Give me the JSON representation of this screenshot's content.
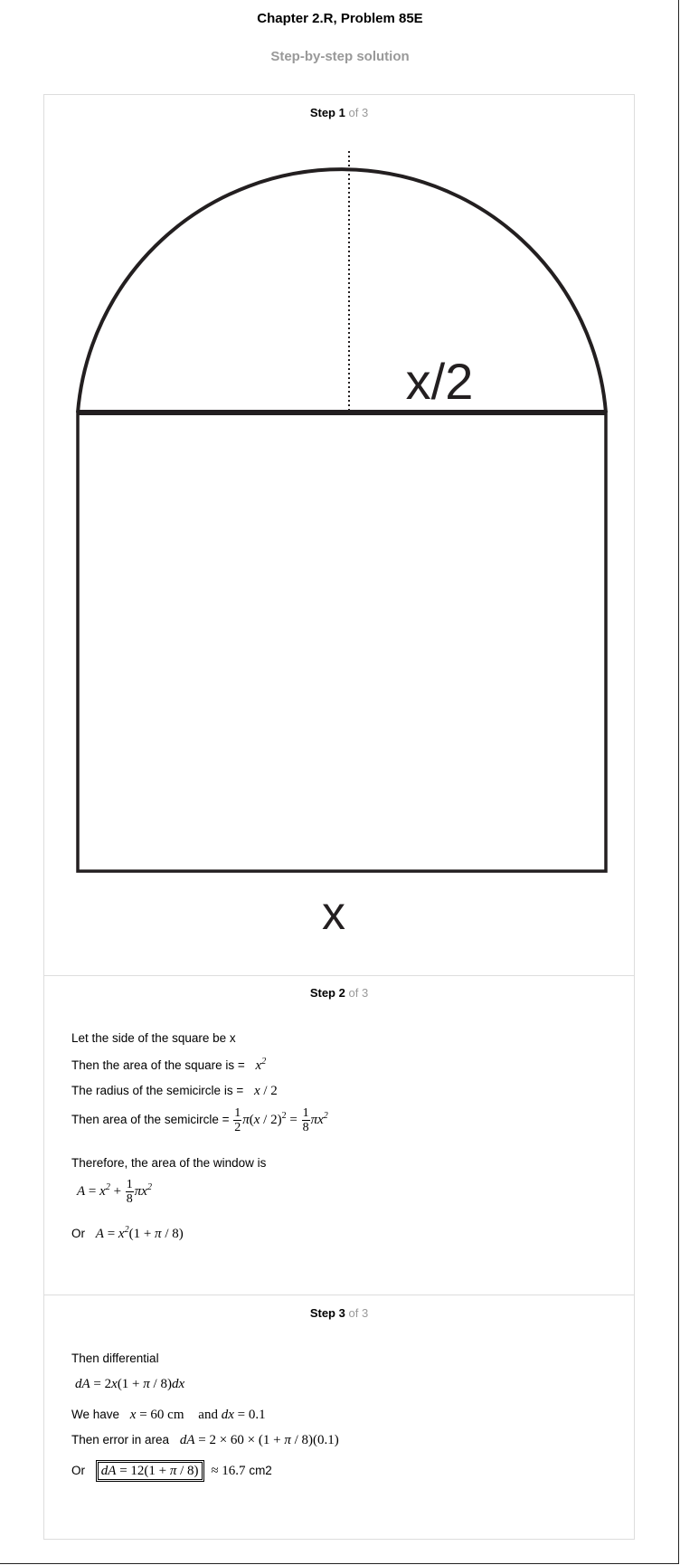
{
  "header": {
    "title": "Chapter 2.R, Problem 85E",
    "subtitle": "Step-by-step solution"
  },
  "steps": [
    {
      "label": "Step",
      "num": "1",
      "of": "of 3"
    },
    {
      "label": "Step",
      "num": "2",
      "of": "of 3"
    },
    {
      "label": "Step",
      "num": "3",
      "of": "of 3"
    }
  ],
  "figure": {
    "radius_label": "x/2",
    "side_label": "x"
  },
  "step2": {
    "l1": "Let the side of the square be x",
    "l2": "Then the area of the square is =",
    "l3": "The radius of the semicircle is =",
    "l4": "Then area of the semicircle =",
    "l5": "Therefore, the area of the window is",
    "l7": "Or"
  },
  "step3": {
    "l1": "Then differential",
    "l3a": "We have",
    "l3b": "and",
    "l4": "Then error in area",
    "l5": "Or",
    "unit": "cm2"
  }
}
